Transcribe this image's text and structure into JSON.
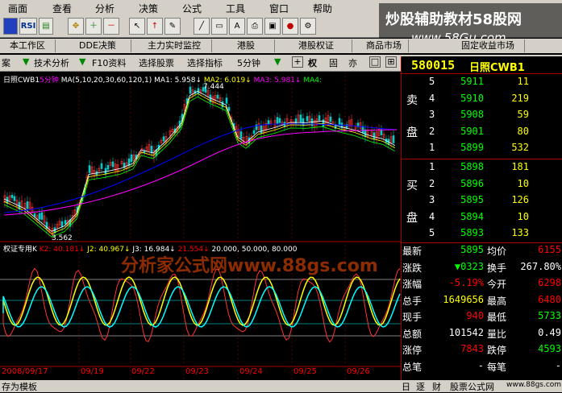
{
  "menu": [
    "画面",
    "查看",
    "分析",
    "决策",
    "公式",
    "工具",
    "窗口",
    "帮助"
  ],
  "toolbar_buttons": [
    "本工作区",
    "DDE决策",
    "主力实时监控",
    "港股",
    "港股权证",
    "商品市场",
    "固定收益市场"
  ],
  "func_items": [
    "案",
    "技术分析",
    "F10资料",
    "选择股票",
    "选择指标",
    "5分钟"
  ],
  "func_icons": [
    "权",
    "固",
    "亦"
  ],
  "stock": {
    "code": "580015",
    "name": "日照CWB1"
  },
  "chart_header": {
    "name": "日照CWB1",
    "period": "5分钟",
    "ma_params": "MA(5,10,20,30,60,120,1)",
    "ma1": "MA1: 5.958↓",
    "ma2": "MA2: 6.019↓",
    "ma3": "MA3: 5.981↓",
    "ma4": "MA4:"
  },
  "price_labels": {
    "high": "7.444",
    "low": "3.562"
  },
  "kdj_header": {
    "name": "权证专用K",
    "k": "K2: 40.181↓",
    "j": "J2: 40.967↓",
    "j3": "J3: 16.984↓",
    "x": "21.554↓",
    "params": "20.000, 50.000, 80.000"
  },
  "watermark_text": "炒股辅助教材58股网",
  "watermark_url": "www.58Gu.com",
  "overlay_text": "分析家公式网www.88gs.com",
  "x_dates": [
    "2008/09/17",
    "09/19",
    "09/22",
    "09/23",
    "09/24",
    "09/25",
    "09/26"
  ],
  "sell": [
    {
      "lvl": "5",
      "price": "5911",
      "vol": "11"
    },
    {
      "lvl": "4",
      "price": "5910",
      "vol": "219"
    },
    {
      "lvl": "3",
      "price": "5908",
      "vol": "59"
    },
    {
      "lvl": "2",
      "price": "5901",
      "vol": "80"
    },
    {
      "lvl": "1",
      "price": "5899",
      "vol": "532"
    }
  ],
  "buy": [
    {
      "lvl": "1",
      "price": "5898",
      "vol": "181"
    },
    {
      "lvl": "2",
      "price": "5896",
      "vol": "10"
    },
    {
      "lvl": "3",
      "price": "5895",
      "vol": "126"
    },
    {
      "lvl": "4",
      "price": "5894",
      "vol": "10"
    },
    {
      "lvl": "5",
      "price": "5893",
      "vol": "133"
    }
  ],
  "sell_label": [
    "卖",
    "盘"
  ],
  "buy_label": [
    "买",
    "盘"
  ],
  "stats": [
    {
      "l1": "最新",
      "v1": "5895",
      "l2": "均价",
      "v2": "6155"
    },
    {
      "l1": "涨跌",
      "v1": "▼0323",
      "l2": "换手",
      "v2": "267.80%"
    },
    {
      "l1": "涨幅",
      "v1": "-5.19%",
      "l2": "今开",
      "v2": "6298"
    },
    {
      "l1": "总手",
      "v1": "1649656",
      "l2": "最高",
      "v2": "6480"
    },
    {
      "l1": "现手",
      "v1": "940",
      "l2": "最低",
      "v2": "5733"
    },
    {
      "l1": "总额",
      "v1": "101542",
      "l2": "量比",
      "v2": "0.49"
    },
    {
      "l1": "涨停",
      "v1": "7843",
      "l2": "跌停",
      "v2": "4593"
    },
    {
      "l1": "总笔",
      "v1": "-",
      "l2": "每笔",
      "v2": "-"
    }
  ],
  "status": {
    "left": "存为模板",
    "tabs": [
      "日",
      "逐",
      "财"
    ],
    "right": "股票公式网",
    "url": "www.88gs.com"
  },
  "colors": {
    "up": "#ff3030",
    "down": "#00c0c0",
    "yellow": "#ffff00",
    "cyan": "#00ffff",
    "green": "#00e000",
    "gray": "#c0c0c0"
  }
}
